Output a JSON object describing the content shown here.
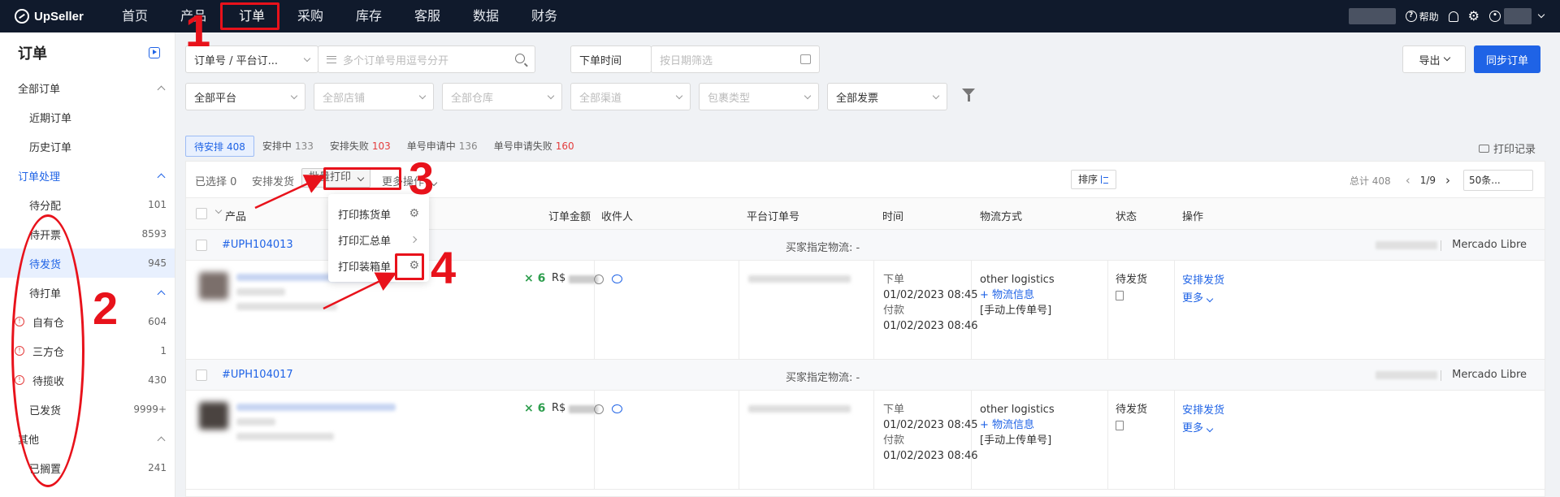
{
  "app": {
    "name": "UpSeller"
  },
  "topnav": {
    "items": [
      "首页",
      "产品",
      "订单",
      "采购",
      "库存",
      "客服",
      "数据",
      "财务"
    ],
    "help": "帮助"
  },
  "sidebar": {
    "title": "订单",
    "sections": [
      {
        "label": "全部订单"
      },
      {
        "label": "近期订单"
      },
      {
        "label": "历史订单"
      },
      {
        "label": "订单处理"
      },
      {
        "label": "待分配",
        "count": "101"
      },
      {
        "label": "待开票",
        "count": "8593"
      },
      {
        "label": "待发货",
        "count": "945"
      },
      {
        "label": "待打单"
      },
      {
        "label": "自有仓",
        "count": "604"
      },
      {
        "label": "三方仓",
        "count": "1"
      },
      {
        "label": "待揽收",
        "count": "430"
      },
      {
        "label": "已发货",
        "count": "9999+"
      },
      {
        "label": "其他"
      },
      {
        "label": "已搁置",
        "count": "241"
      }
    ]
  },
  "filters": {
    "order_type": "订单号 / 平台订...",
    "order_search_placeholder": "多个订单号用逗号分开",
    "time_type": "下单时间",
    "date_placeholder": "按日期筛选",
    "platform": "全部平台",
    "shop": "全部店铺",
    "warehouse": "全部仓库",
    "channel": "全部渠道",
    "package": "包裹类型",
    "invoice": "全部发票"
  },
  "actions": {
    "export": "导出",
    "sync": "同步订单",
    "print_record": "打印记录"
  },
  "status_tabs": [
    {
      "label": "待安排",
      "count": "408"
    },
    {
      "label": "安排中",
      "count": "133"
    },
    {
      "label": "安排失败",
      "count": "103"
    },
    {
      "label": "单号申请中",
      "count": "136"
    },
    {
      "label": "单号申请失败",
      "count": "160"
    }
  ],
  "toolbar": {
    "selected_label": "已选择",
    "selected_count": "0",
    "arrange": "安排发货",
    "batch_print": "批量打印",
    "more_ops": "更多操作",
    "sort": "排序",
    "total": "总计 408",
    "page": "1/9",
    "page_size": "50条..."
  },
  "columns": [
    "产品",
    "订单金额",
    "收件人",
    "平台订单号",
    "时间",
    "物流方式",
    "状态",
    "操作"
  ],
  "print_menu": [
    "打印拣货单",
    "打印汇总单",
    "打印装箱单"
  ],
  "orders": [
    {
      "id": "#UPH104013",
      "buyer_logistics": "买家指定物流: -",
      "platform": "Mercado Libre",
      "qty": "× 6",
      "currency": "R$",
      "time_order_label": "下单",
      "time_order": "01/02/2023 08:45",
      "time_pay_label": "付款",
      "time_pay": "01/02/2023 08:46",
      "logistics": "other logistics",
      "logistics_info": "+ 物流信息",
      "tracking": "[手动上传单号]",
      "status": "待发货",
      "op_primary": "安排发货",
      "op_more": "更多"
    },
    {
      "id": "#UPH104017",
      "buyer_logistics": "买家指定物流: -",
      "platform": "Mercado Libre",
      "qty": "× 6",
      "currency": "R$",
      "time_order_label": "下单",
      "time_order": "01/02/2023 08:45",
      "time_pay_label": "付款",
      "time_pay": "01/02/2023 08:46",
      "logistics": "other logistics",
      "logistics_info": "+ 物流信息",
      "tracking": "[手动上传单号]",
      "status": "待发货",
      "op_primary": "安排发货",
      "op_more": "更多"
    }
  ],
  "annotations": [
    "1",
    "2",
    "3",
    "4"
  ],
  "colors": {
    "nav_bg": "#101a2c",
    "accent": "#1f63e6",
    "annotation": "#e8121b",
    "warn": "#e43c3c",
    "qty": "#2e9e4e"
  }
}
